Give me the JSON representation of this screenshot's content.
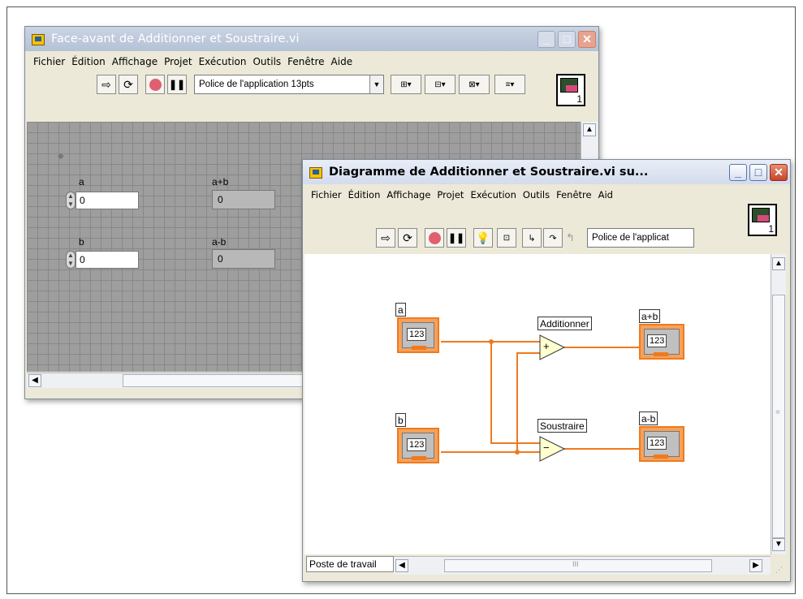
{
  "front_panel": {
    "title": "Face-avant de Additionner et Soustraire.vi",
    "menu": [
      "Fichier",
      "Édition",
      "Affichage",
      "Projet",
      "Exécution",
      "Outils",
      "Fenêtre",
      "Aide"
    ],
    "font_selector": "Police de l'application 13pts",
    "vi_icon_number": "1",
    "controls": {
      "a_label": "a",
      "a_value": "0",
      "b_label": "b",
      "b_value": "0"
    },
    "indicators": {
      "sum_label": "a+b",
      "sum_value": "0",
      "diff_label": "a-b",
      "diff_value": "0"
    }
  },
  "block_diagram": {
    "title": "Diagramme de Additionner et Soustraire.vi su...",
    "menu": [
      "Fichier",
      "Édition",
      "Affichage",
      "Projet",
      "Exécution",
      "Outils",
      "Fenêtre",
      "Aid"
    ],
    "font_selector": "Police de l'applicat",
    "vi_icon_number": "1",
    "terminals": {
      "a_label": "a",
      "b_label": "b",
      "sum_label": "a+b",
      "diff_label": "a-b",
      "numeric_text": "123"
    },
    "nodes": {
      "add_label": "Additionner",
      "add_symbol": "+",
      "sub_label": "Soustraire",
      "sub_symbol": "−"
    },
    "status_target": "Poste de travail",
    "scrollbar_grip": "III",
    "vscroll_grip": "="
  },
  "colors": {
    "wire_orange": "#ef7a1e",
    "grid_gray": "#9e9e9e",
    "node_yellow": "#ffffd0"
  }
}
